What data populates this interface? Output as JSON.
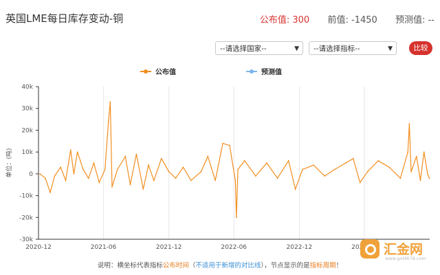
{
  "header": {
    "title": "英国LME每日库存变动-铜",
    "published_label": "公布值:",
    "published_value": "300",
    "previous_label": "前值:",
    "previous_value": "-1450",
    "forecast_label": "预测值:",
    "forecast_value": "--"
  },
  "toolbar": {
    "country_select": "--请选择国家--",
    "indicator_select": "--请选择指标--",
    "compare_button": "比较"
  },
  "footer": {
    "prefix": "说明：横坐标代表指标",
    "pub_time": "公布时间",
    "paren_open": "（",
    "note": "不适用于新增的对比线",
    "paren_close": "），节点显示的是",
    "period": "指标周期",
    "suffix": "！"
  },
  "watermark": {
    "text": "汇金网",
    "sub": "www.gold678.com"
  },
  "colors": {
    "published": "#f28d1e",
    "forecast": "#7cb5ec",
    "accent": "#d6322e"
  },
  "chart_data": {
    "type": "line",
    "ylabel": "单位：(吨)",
    "ylim": [
      -30000,
      40000
    ],
    "yticks": [
      -30000,
      -20000,
      -10000,
      0,
      10000,
      20000,
      30000,
      40000
    ],
    "ytick_labels": [
      "-30k",
      "-20k",
      "-10k",
      "0",
      "10k",
      "20k",
      "30k",
      "40k"
    ],
    "xlim": [
      "2020-12-01",
      "2023-12-01"
    ],
    "xticks": [
      "2020-12-01",
      "2021-06-01",
      "2021-12-01",
      "2022-06-01",
      "2022-12-01",
      "2023-06-01"
    ],
    "xtick_labels": [
      "2020-12",
      "2021-06",
      "2021-12",
      "2022-06",
      "2022-12",
      "2023-06"
    ],
    "grid": {
      "vertical": true,
      "horizontal": false
    },
    "legend": {
      "position": "top-center",
      "entries": [
        "公布值",
        "预测值"
      ]
    },
    "series": [
      {
        "name": "公布值",
        "color": "#f28d1e",
        "points": [
          [
            "2020-12-05",
            0
          ],
          [
            "2020-12-20",
            -2000
          ],
          [
            "2021-01-03",
            -8500
          ],
          [
            "2021-01-15",
            -1000
          ],
          [
            "2021-02-01",
            3000
          ],
          [
            "2021-02-15",
            -3000
          ],
          [
            "2021-03-01",
            11000
          ],
          [
            "2021-03-10",
            0
          ],
          [
            "2021-03-20",
            10000
          ],
          [
            "2021-04-05",
            2000
          ],
          [
            "2021-04-20",
            -2000
          ],
          [
            "2021-05-05",
            5000
          ],
          [
            "2021-05-20",
            -4000
          ],
          [
            "2021-06-05",
            2000
          ],
          [
            "2021-06-15",
            24000
          ],
          [
            "2021-06-20",
            33000
          ],
          [
            "2021-06-25",
            -6000
          ],
          [
            "2021-07-10",
            2000
          ],
          [
            "2021-08-01",
            8000
          ],
          [
            "2021-08-15",
            -5000
          ],
          [
            "2021-09-01",
            9000
          ],
          [
            "2021-09-20",
            -7000
          ],
          [
            "2021-10-05",
            4000
          ],
          [
            "2021-10-20",
            -3000
          ],
          [
            "2021-11-10",
            7000
          ],
          [
            "2021-12-01",
            1000
          ],
          [
            "2021-12-20",
            -2000
          ],
          [
            "2022-01-10",
            3000
          ],
          [
            "2022-02-01",
            -3000
          ],
          [
            "2022-03-01",
            1000
          ],
          [
            "2022-03-20",
            8000
          ],
          [
            "2022-04-10",
            -3000
          ],
          [
            "2022-05-01",
            14000
          ],
          [
            "2022-05-20",
            13000
          ],
          [
            "2022-06-05",
            -3000
          ],
          [
            "2022-06-08",
            -20000
          ],
          [
            "2022-06-12",
            2000
          ],
          [
            "2022-07-01",
            6000
          ],
          [
            "2022-08-01",
            -1000
          ],
          [
            "2022-09-01",
            5000
          ],
          [
            "2022-10-01",
            -2000
          ],
          [
            "2022-11-01",
            6000
          ],
          [
            "2022-11-20",
            -7000
          ],
          [
            "2022-12-10",
            2000
          ],
          [
            "2023-01-10",
            4000
          ],
          [
            "2023-02-10",
            -1000
          ],
          [
            "2023-03-10",
            2000
          ],
          [
            "2023-04-10",
            5000
          ],
          [
            "2023-05-01",
            7000
          ],
          [
            "2023-05-20",
            -4000
          ],
          [
            "2023-06-10",
            1000
          ],
          [
            "2023-07-10",
            6000
          ],
          [
            "2023-08-10",
            3000
          ],
          [
            "2023-09-10",
            -2000
          ],
          [
            "2023-10-01",
            10000
          ],
          [
            "2023-10-05",
            23000
          ],
          [
            "2023-10-10",
            1000
          ],
          [
            "2023-10-25",
            8000
          ],
          [
            "2023-11-05",
            -3000
          ],
          [
            "2023-11-15",
            10000
          ],
          [
            "2023-11-25",
            0
          ],
          [
            "2023-11-30",
            -2000
          ]
        ]
      },
      {
        "name": "预测值",
        "color": "#7cb5ec",
        "points": []
      }
    ]
  }
}
